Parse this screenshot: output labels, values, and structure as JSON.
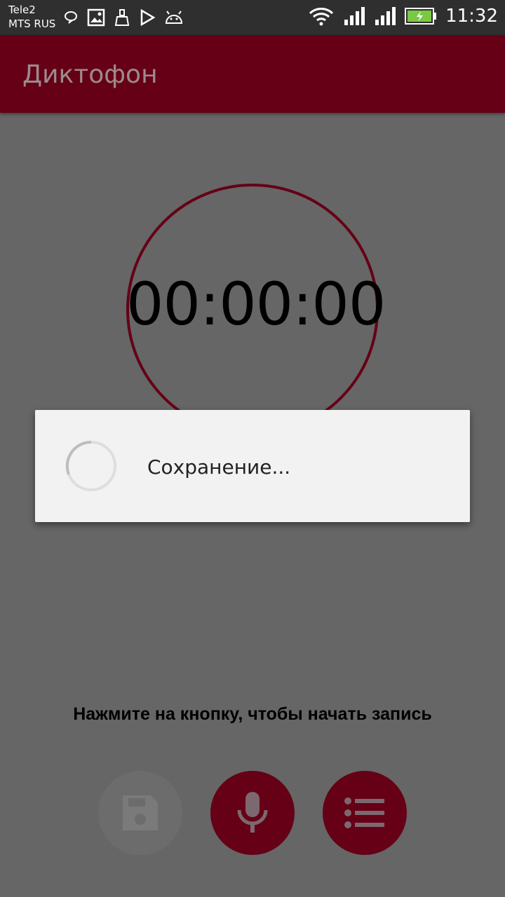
{
  "status_bar": {
    "carrier1": "Tele2",
    "carrier2": "MTS RUS",
    "time": "11:32",
    "icons": [
      "chat-icon",
      "image-icon",
      "cleaner-icon",
      "play-store-icon",
      "android-icon",
      "wifi-icon",
      "signal-icon",
      "signal-icon-2",
      "battery-charging-icon"
    ]
  },
  "app_bar": {
    "title": "Диктофон",
    "color": "#650016"
  },
  "timer": {
    "value": "00:00:00"
  },
  "dialog": {
    "message": "Сохранение..."
  },
  "hint": "Нажмите на кнопку, чтобы начать запись",
  "buttons": {
    "save": {
      "icon": "floppy-disk-icon",
      "enabled": false
    },
    "record": {
      "icon": "microphone-icon"
    },
    "list": {
      "icon": "list-icon"
    }
  },
  "colors": {
    "accent": "#650016",
    "overlay": "#666666"
  }
}
